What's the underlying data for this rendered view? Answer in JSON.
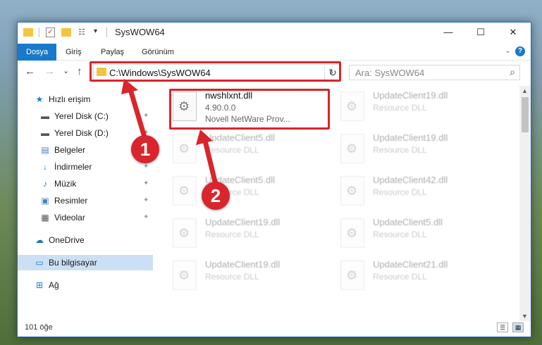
{
  "window": {
    "title": "SysWOW64",
    "minimize": "—",
    "maximize": "☐",
    "close": "✕"
  },
  "ribbon": {
    "tabs": [
      {
        "label": "Dosya",
        "active": true
      },
      {
        "label": "Giriş"
      },
      {
        "label": "Paylaş"
      },
      {
        "label": "Görünüm"
      }
    ],
    "help": "?"
  },
  "nav": {
    "back": "←",
    "forward": "→",
    "recent": "⌄",
    "up": "↑",
    "address": "C:\\Windows\\SysWOW64",
    "refresh": "↻",
    "search_placeholder": "Ara: SysWOW64"
  },
  "sidebar": {
    "items": [
      {
        "label": "Hızlı erişim",
        "icon": "star-icon",
        "glyph": "★",
        "color": "#1e7bd6"
      },
      {
        "label": "Yerel Disk (C:)",
        "icon": "drive-icon",
        "glyph": "▬",
        "color": "#555",
        "pinned": true
      },
      {
        "label": "Yerel Disk (D:)",
        "icon": "drive-icon",
        "glyph": "▬",
        "color": "#555",
        "pinned": true
      },
      {
        "label": "Belgeler",
        "icon": "documents-icon",
        "glyph": "▤",
        "color": "#4a7fb8",
        "pinned": true
      },
      {
        "label": "İndirmeler",
        "icon": "download-icon",
        "glyph": "↓",
        "color": "#1e7bd6",
        "pinned": true
      },
      {
        "label": "Müzik",
        "icon": "music-icon",
        "glyph": "♪",
        "color": "#1e7bd6",
        "pinned": true
      },
      {
        "label": "Resimler",
        "icon": "pictures-icon",
        "glyph": "▣",
        "color": "#4a7fb8",
        "pinned": true
      },
      {
        "label": "Videolar",
        "icon": "videos-icon",
        "glyph": "▦",
        "color": "#555",
        "pinned": true
      },
      {
        "label": "OneDrive",
        "icon": "cloud-icon",
        "glyph": "☁",
        "color": "#1e6fc0"
      },
      {
        "label": "Bu bilgisayar",
        "icon": "computer-icon",
        "glyph": "▭",
        "color": "#1e7bd6",
        "selected": true
      },
      {
        "label": "Ağ",
        "icon": "network-icon",
        "glyph": "⊞",
        "color": "#1e7bd6"
      }
    ]
  },
  "files": [
    {
      "name": "nwshlxnt.dll",
      "line2": "4.90.0.0",
      "line3": "Novell NetWare Prov..."
    },
    {
      "name": "UpdateClient19.dll",
      "line2": "Resource DLL",
      "line3": ""
    },
    {
      "name": "UpdateClient5.dll",
      "line2": "Resource DLL",
      "line3": ""
    },
    {
      "name": "UpdateClient19.dll",
      "line2": "Resource DLL",
      "line3": ""
    },
    {
      "name": "UpdateClient5.dll",
      "line2": "Resource DLL",
      "line3": ""
    },
    {
      "name": "UpdateClient42.dll",
      "line2": "Resource DLL",
      "line3": ""
    },
    {
      "name": "UpdateClient19.dll",
      "line2": "Resource DLL",
      "line3": ""
    },
    {
      "name": "UpdateClient5.dll",
      "line2": "Resource DLL",
      "line3": ""
    },
    {
      "name": "UpdateClient19.dll",
      "line2": "Resource DLL",
      "line3": ""
    },
    {
      "name": "UpdateClient21.dll",
      "line2": "Resource DLL",
      "line3": ""
    }
  ],
  "status": {
    "count": "101 öğe"
  },
  "callouts": {
    "one": "1",
    "two": "2"
  },
  "colors": {
    "accent": "#1979ca",
    "highlight": "#d9252b"
  }
}
